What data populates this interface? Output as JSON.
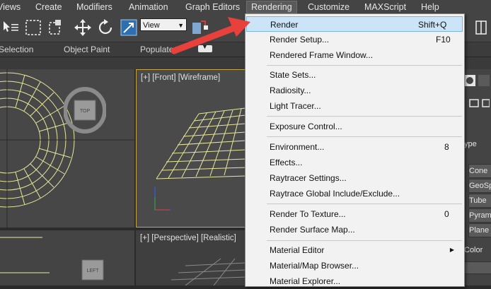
{
  "menubar": {
    "items": [
      {
        "label": "Views"
      },
      {
        "label": "Create"
      },
      {
        "label": "Modifiers"
      },
      {
        "label": "Animation"
      },
      {
        "label": "Graph Editors"
      },
      {
        "label": "Rendering"
      },
      {
        "label": "Customize"
      },
      {
        "label": "MAXScript"
      },
      {
        "label": "Help"
      }
    ],
    "active": "Rendering"
  },
  "toolbar": {
    "view_select": "View"
  },
  "ribbon": {
    "selection": "Selection",
    "object_paint": "Object Paint",
    "populate": "Populate"
  },
  "viewports": {
    "front": "[+] [Front] [Wireframe]",
    "perspective": "[+] [Perspective] [Realistic]",
    "viewcube_top": "TOP",
    "viewcube_left": "LEFT"
  },
  "command_panel": {
    "items": [
      "s",
      "ype",
      "Cone",
      "GeoSphe",
      "Tube",
      "Pyrami",
      "Plane",
      "Color"
    ]
  },
  "rendering_menu": {
    "items": [
      {
        "label": "Render",
        "shortcut": "Shift+Q"
      },
      {
        "label": "Render Setup...",
        "shortcut": "F10"
      },
      {
        "label": "Rendered Frame Window...",
        "shortcut": ""
      },
      {
        "label": "State Sets...",
        "shortcut": ""
      },
      {
        "label": "Radiosity...",
        "shortcut": ""
      },
      {
        "label": "Light Tracer...",
        "shortcut": ""
      },
      {
        "label": "Exposure Control...",
        "shortcut": ""
      },
      {
        "label": "Environment...",
        "shortcut": "8"
      },
      {
        "label": "Effects...",
        "shortcut": ""
      },
      {
        "label": "Raytracer Settings...",
        "shortcut": ""
      },
      {
        "label": "Raytrace Global Include/Exclude...",
        "shortcut": ""
      },
      {
        "label": "Render To Texture...",
        "shortcut": "0"
      },
      {
        "label": "Render Surface Map...",
        "shortcut": ""
      },
      {
        "label": "Material Editor",
        "shortcut": ""
      },
      {
        "label": "Material/Map Browser...",
        "shortcut": ""
      },
      {
        "label": "Material Explorer...",
        "shortcut": ""
      }
    ]
  },
  "colors": {
    "menu_highlight": "#cce4f7",
    "arrow": "#e8413c",
    "wireframe": "#e8e89a",
    "viewport_border_active": "#c9a64a"
  }
}
